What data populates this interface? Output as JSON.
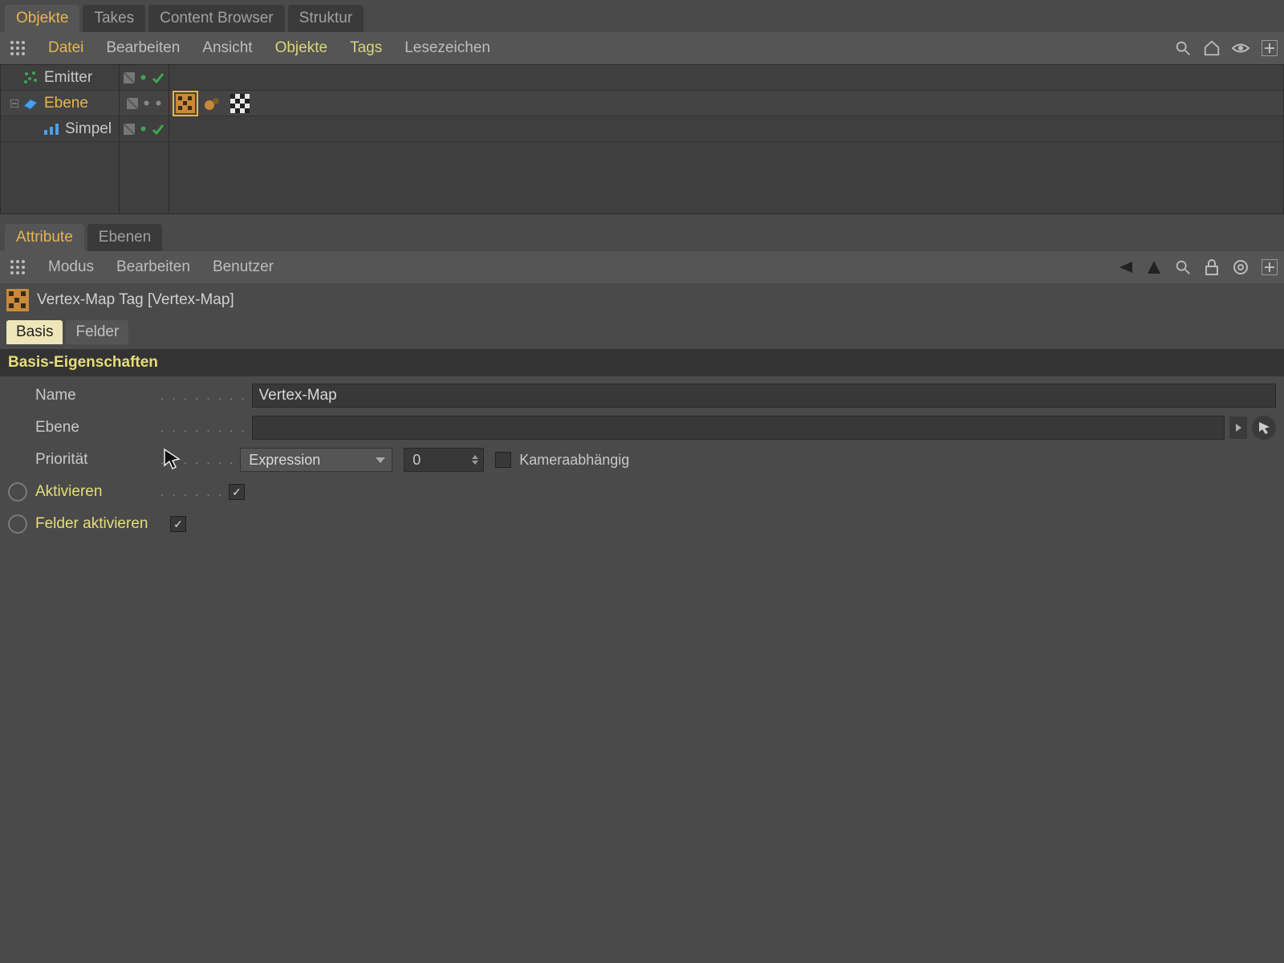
{
  "top_tabs": [
    {
      "label": "Objekte",
      "active": true
    },
    {
      "label": "Takes",
      "active": false
    },
    {
      "label": "Content Browser",
      "active": false
    },
    {
      "label": "Struktur",
      "active": false
    }
  ],
  "obj_menu": {
    "datei": "Datei",
    "bearbeiten": "Bearbeiten",
    "ansicht": "Ansicht",
    "objekte": "Objekte",
    "tags": "Tags",
    "lesezeichen": "Lesezeichen"
  },
  "objects": {
    "emitter": "Emitter",
    "ebene": "Ebene",
    "simpel": "Simpel"
  },
  "attr_tabs": [
    {
      "label": "Attribute",
      "active": true
    },
    {
      "label": "Ebenen",
      "active": false
    }
  ],
  "attr_menu": {
    "modus": "Modus",
    "bearbeiten": "Bearbeiten",
    "benutzer": "Benutzer"
  },
  "tag_header": "Vertex-Map Tag [Vertex-Map]",
  "subtabs": [
    {
      "label": "Basis",
      "active": true
    },
    {
      "label": "Felder",
      "active": false
    }
  ],
  "section_title": "Basis-Eigenschaften",
  "props": {
    "name_label": "Name",
    "name_value": "Vertex-Map",
    "ebene_label": "Ebene",
    "ebene_value": "",
    "prio_label": "Priorität",
    "prio_dropdown": "Expression",
    "prio_value": "0",
    "camera_label": "Kameraabhängig",
    "camera_checked": false,
    "aktivieren_label": "Aktivieren",
    "aktivieren_checked": true,
    "felderakt_label": "Felder aktivieren",
    "felderakt_checked": true
  }
}
